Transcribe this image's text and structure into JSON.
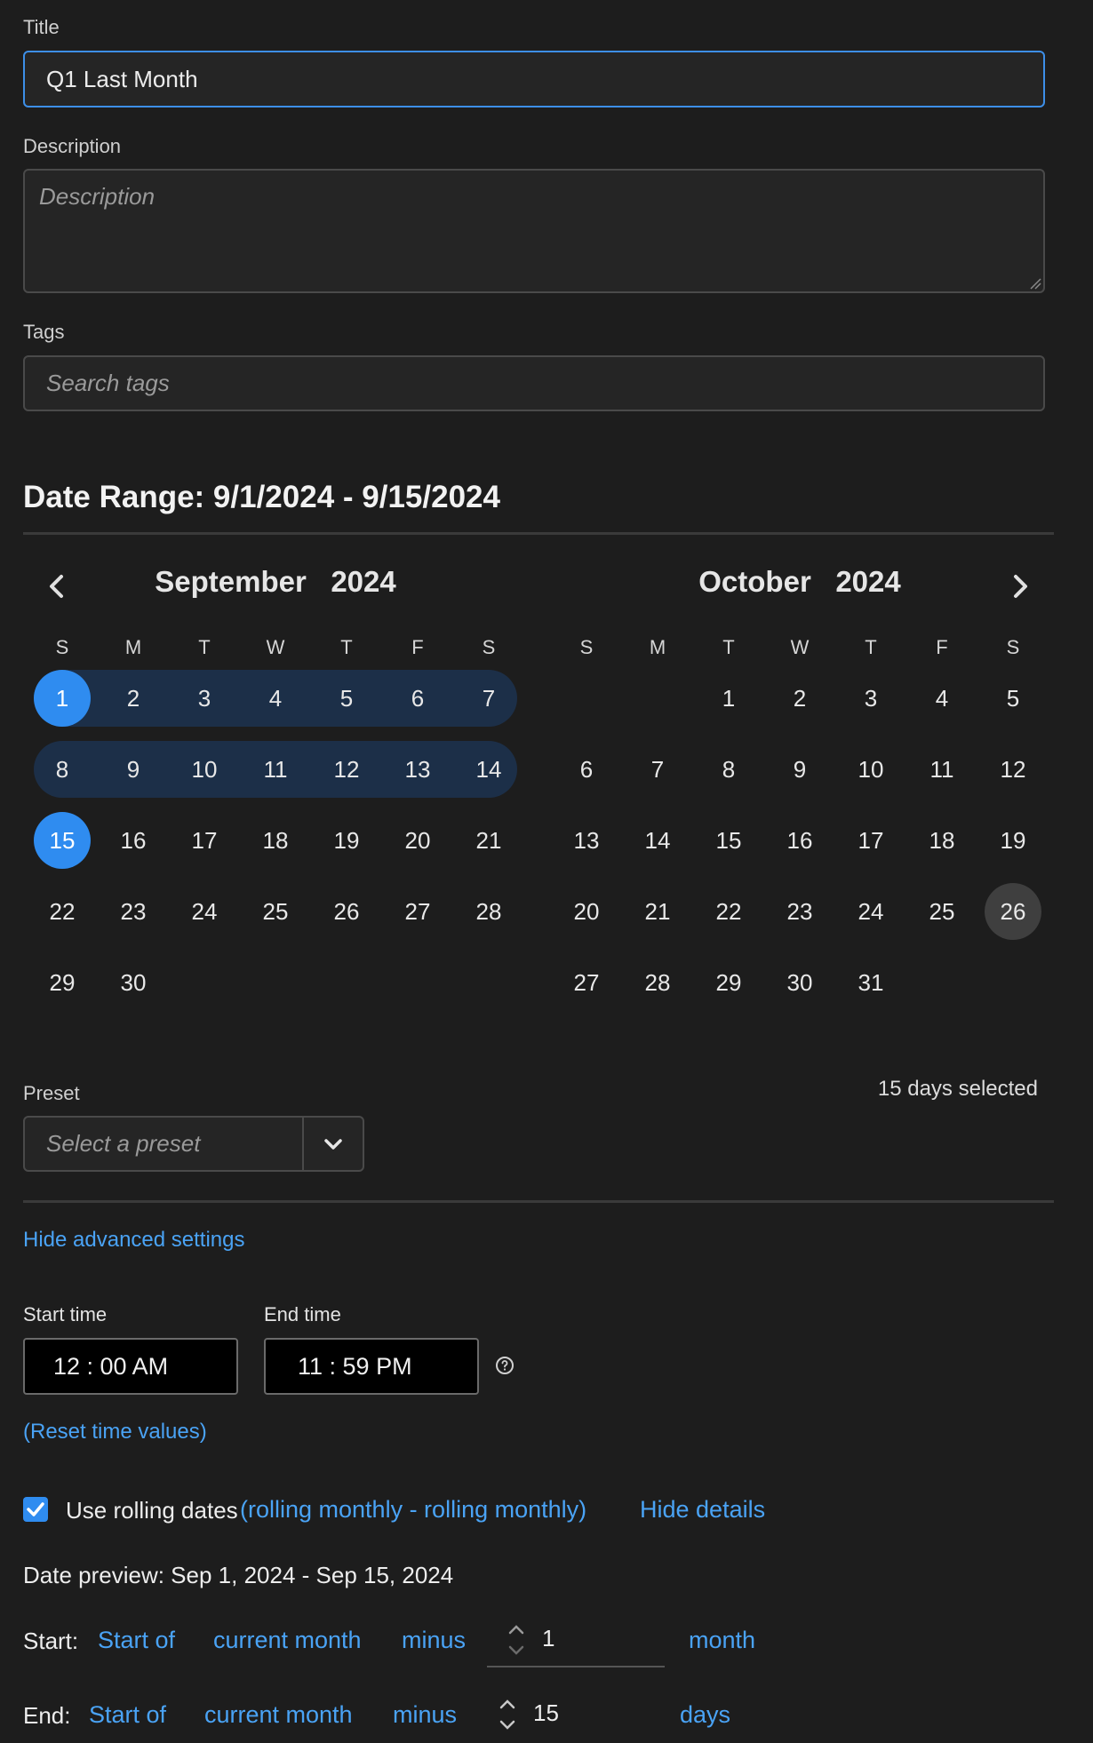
{
  "form": {
    "title_label": "Title",
    "title_value": "Q1 Last Month",
    "description_label": "Description",
    "description_placeholder": "Description",
    "tags_label": "Tags",
    "tags_placeholder": "Search tags"
  },
  "date_range": {
    "heading": "Date Range: 9/1/2024 - 9/15/2024",
    "days_selected": "15 days selected",
    "selected_start": 1,
    "selected_end": 15,
    "today": {
      "month": "October",
      "day": 26
    }
  },
  "calendar": {
    "weekdays": [
      "S",
      "M",
      "T",
      "W",
      "T",
      "F",
      "S"
    ],
    "months": [
      {
        "name": "September",
        "year": "2024",
        "first_weekday": 0,
        "days": 30
      },
      {
        "name": "October",
        "year": "2024",
        "first_weekday": 2,
        "days": 31
      }
    ]
  },
  "preset": {
    "label": "Preset",
    "placeholder": "Select a preset"
  },
  "advanced": {
    "toggle_label": "Hide advanced settings",
    "start_time_label": "Start time",
    "start_time_value": "12 : 00  AM",
    "end_time_label": "End time",
    "end_time_value": "11 : 59  PM",
    "reset_label": "(Reset time values)"
  },
  "rolling": {
    "checkbox_label": "Use rolling dates",
    "checked": true,
    "mode_text": "(rolling monthly - rolling monthly)",
    "hide_details_label": "Hide details",
    "preview": "Date preview: Sep 1, 2024 - Sep 15, 2024",
    "start": {
      "label": "Start:",
      "anchor": "Start of",
      "period": "current month",
      "op": "minus",
      "amount": "1",
      "unit": "month"
    },
    "end": {
      "label": "End:",
      "anchor": "Start of",
      "period": "current month",
      "op": "minus",
      "amount": "15",
      "unit": "days"
    }
  },
  "colors": {
    "accent": "#2f8cf0",
    "range": "#1c2f48",
    "link": "#4aa3f5",
    "background": "#1d1d1d"
  }
}
